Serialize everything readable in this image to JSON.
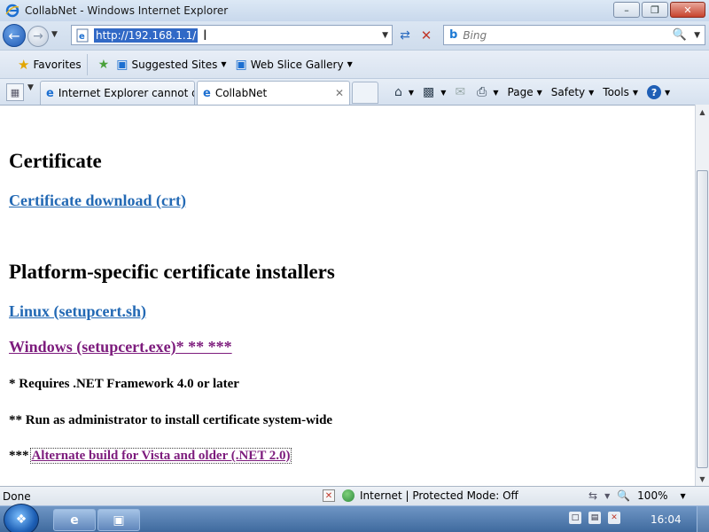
{
  "window": {
    "title": "CollabNet - Windows Internet Explorer",
    "minimize": "–",
    "maximize": "❐",
    "close": "✕"
  },
  "address": {
    "url": "http://192.168.1.1/"
  },
  "search": {
    "placeholder": "Bing"
  },
  "favorites": {
    "label": "Favorites",
    "items": [
      {
        "label": "Suggested Sites"
      },
      {
        "label": "Web Slice Gallery"
      }
    ]
  },
  "tabs": [
    {
      "label": "Internet Explorer cannot d...",
      "active": false
    },
    {
      "label": "CollabNet",
      "active": true
    }
  ],
  "commands": {
    "page": "Page",
    "safety": "Safety",
    "tools": "Tools"
  },
  "content": {
    "cert_heading": "Certificate",
    "cert_link": "Certificate download (crt)",
    "installers_heading": "Platform-specific certificate installers",
    "linux_link": "Linux (setupcert.sh)",
    "windows_link": "Windows (setupcert.exe)* ** ***",
    "note1": "* Requires .NET Framework 4.0 or later",
    "note2": "** Run as administrator to install certificate system-wide",
    "note3_prefix": "*** ",
    "note3_link": "Alternate build for Vista and older (.NET 2.0)"
  },
  "status": {
    "text": "Done",
    "zone": "Internet | Protected Mode: Off",
    "zoom": "100%"
  },
  "taskbar": {
    "clock": "16:04"
  },
  "colors": {
    "link": "#2369b4",
    "visited_link": "#7d1c7d",
    "taskbar": "#4f78ad"
  }
}
